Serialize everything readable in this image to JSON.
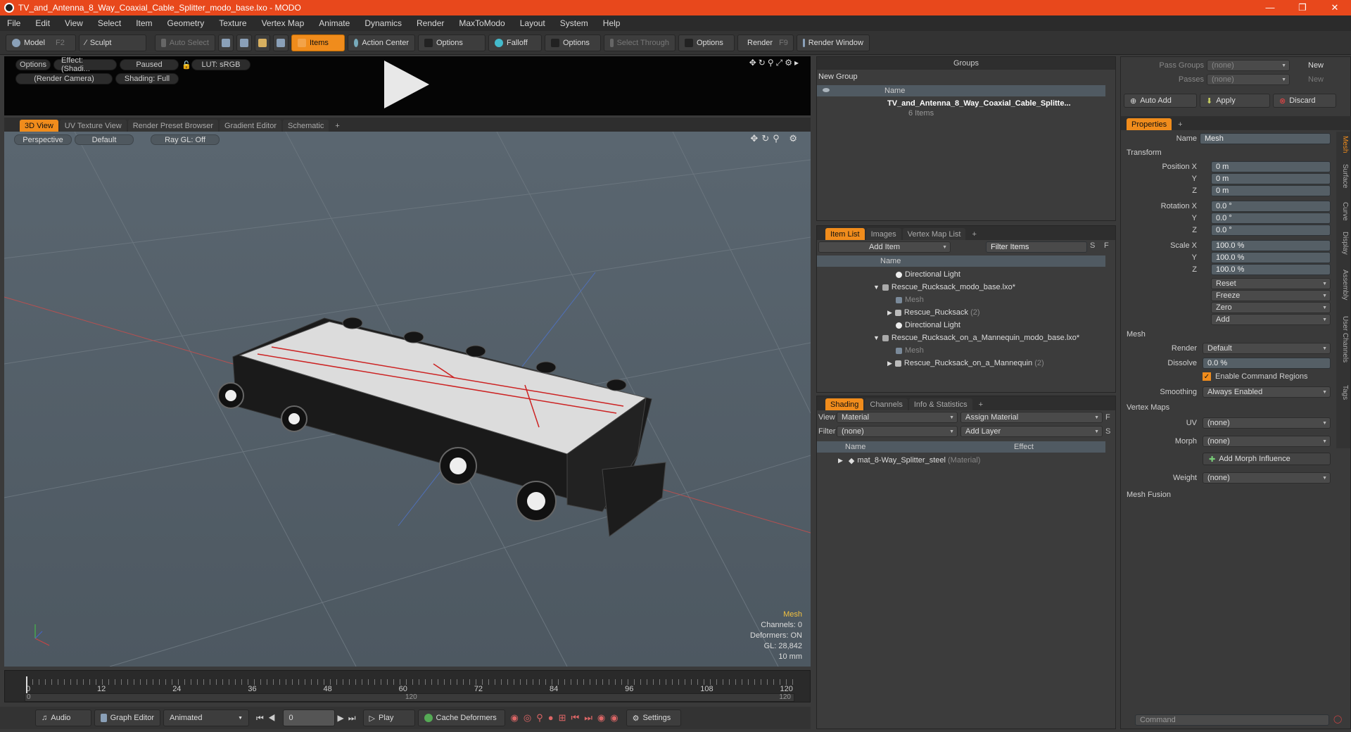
{
  "window": {
    "title": "TV_and_Antenna_8_Way_Coaxial_Cable_Splitter_modo_base.lxo - MODO",
    "controls": [
      "—",
      "❐",
      "✕"
    ]
  },
  "menu": [
    "File",
    "Edit",
    "View",
    "Select",
    "Item",
    "Geometry",
    "Texture",
    "Vertex Map",
    "Animate",
    "Dynamics",
    "Render",
    "MaxToModo",
    "Layout",
    "System",
    "Help"
  ],
  "toolbar": {
    "model": "Model",
    "model_key": "F2",
    "sculpt": "Sculpt",
    "auto_select": "Auto Select",
    "items": "Items",
    "action_center": "Action Center",
    "options1": "Options",
    "falloff": "Falloff",
    "options2": "Options",
    "select_through": "Select Through",
    "options3": "Options",
    "render": "Render",
    "render_key": "F9",
    "render_window": "Render Window"
  },
  "preview": {
    "options": "Options",
    "effect": "Effect: (Shadi...",
    "paused": "Paused",
    "lut": "LUT: sRGB",
    "camera": "(Render Camera)",
    "shading": "Shading: Full"
  },
  "viewtabs": [
    "3D View",
    "UV Texture View",
    "Render Preset Browser",
    "Gradient Editor",
    "Schematic",
    "+"
  ],
  "viewport": {
    "perspective": "Perspective",
    "default": "Default",
    "raygl": "Ray GL: Off",
    "info_title": "Mesh",
    "channels": "Channels: 0",
    "deformers": "Deformers: ON",
    "gl": "GL: 28,842",
    "scale": "10 mm"
  },
  "timeline": {
    "ticks": [
      "0",
      "12",
      "24",
      "36",
      "48",
      "60",
      "72",
      "84",
      "96",
      "108",
      "120"
    ],
    "sub_start": "0",
    "sub_mid": "120",
    "sub_end": "120"
  },
  "bottombar": {
    "audio": "Audio",
    "graph_editor": "Graph Editor",
    "animated": "Animated",
    "frame": "0",
    "play": "Play",
    "cache": "Cache Deformers",
    "settings": "Settings"
  },
  "groups": {
    "title": "Groups",
    "new_group": "New Group",
    "col_name": "Name",
    "item_name": "TV_and_Antenna_8_Way_Coaxial_Cable_Splitte...",
    "item_count": "6 Items"
  },
  "itemlist": {
    "tabs": [
      "Item List",
      "Images",
      "Vertex Map List",
      "+"
    ],
    "add_item": "Add Item",
    "filter": "Filter Items",
    "s": "S",
    "f": "F",
    "col_name": "Name",
    "rows": [
      {
        "label": "Directional Light",
        "indent": 2,
        "dim": ""
      },
      {
        "label": "Rescue_Rucksack_modo_base.lxo*",
        "indent": 1,
        "dim": ""
      },
      {
        "label": "Mesh",
        "indent": 2,
        "dim": "x"
      },
      {
        "label": "Rescue_Rucksack",
        "indent": 2,
        "dim": "",
        "suffix": "(2)"
      },
      {
        "label": "Directional Light",
        "indent": 2,
        "dim": ""
      },
      {
        "label": "Rescue_Rucksack_on_a_Mannequin_modo_base.lxo*",
        "indent": 1,
        "dim": ""
      },
      {
        "label": "Mesh",
        "indent": 2,
        "dim": "x"
      },
      {
        "label": "Rescue_Rucksack_on_a_Mannequin",
        "indent": 2,
        "dim": "",
        "suffix": "(2)"
      }
    ]
  },
  "shading": {
    "tabs": [
      "Shading",
      "Channels",
      "Info & Statistics",
      "+"
    ],
    "view_label": "View",
    "view_value": "Material",
    "assign": "Assign Material",
    "f": "F",
    "filter_label": "Filter",
    "filter_value": "(none)",
    "add_layer": "Add Layer",
    "s": "S",
    "col_name": "Name",
    "col_effect": "Effect",
    "row_name": "mat_8-Way_Splitter_steel",
    "row_type": "(Material)"
  },
  "props_top": {
    "pass_groups": "Pass Groups",
    "passes": "Passes",
    "none1": "(none)",
    "none2": "(none)",
    "new1": "New",
    "new2": "New",
    "auto_add": "Auto Add",
    "apply": "Apply",
    "discard": "Discard"
  },
  "properties": {
    "tab": "Properties",
    "plus": "+",
    "name_label": "Name",
    "name_value": "Mesh",
    "transform": "Transform",
    "position_label": "Position X",
    "y": "Y",
    "z": "Z",
    "pos": [
      "0 m",
      "0 m",
      "0 m"
    ],
    "rotation_label": "Rotation X",
    "rot": [
      "0.0 °",
      "0.0 °",
      "0.0 °"
    ],
    "scale_label": "Scale X",
    "scl": [
      "100.0 %",
      "100.0 %",
      "100.0 %"
    ],
    "actions": [
      "Reset",
      "Freeze",
      "Zero",
      "Add"
    ],
    "mesh": "Mesh",
    "render_label": "Render",
    "render_value": "Default",
    "dissolve_label": "Dissolve",
    "dissolve_value": "0.0 %",
    "command_regions": "Enable Command Regions",
    "smoothing_label": "Smoothing",
    "smoothing_value": "Always Enabled",
    "vertex_maps": "Vertex Maps",
    "uv_label": "UV",
    "uv_value": "(none)",
    "morph_label": "Morph",
    "morph_value": "(none)",
    "add_morph": "Add Morph Influence",
    "weight_label": "Weight",
    "weight_value": "(none)",
    "mesh_fusion": "Mesh Fusion",
    "vtabs": [
      "Mesh",
      "Surface",
      "Curve",
      "Display",
      "Assembly",
      "User Channels",
      "Tags"
    ],
    "command": "Command"
  },
  "colors": {
    "accent": "#f08c1c",
    "title": "#e8481c"
  }
}
